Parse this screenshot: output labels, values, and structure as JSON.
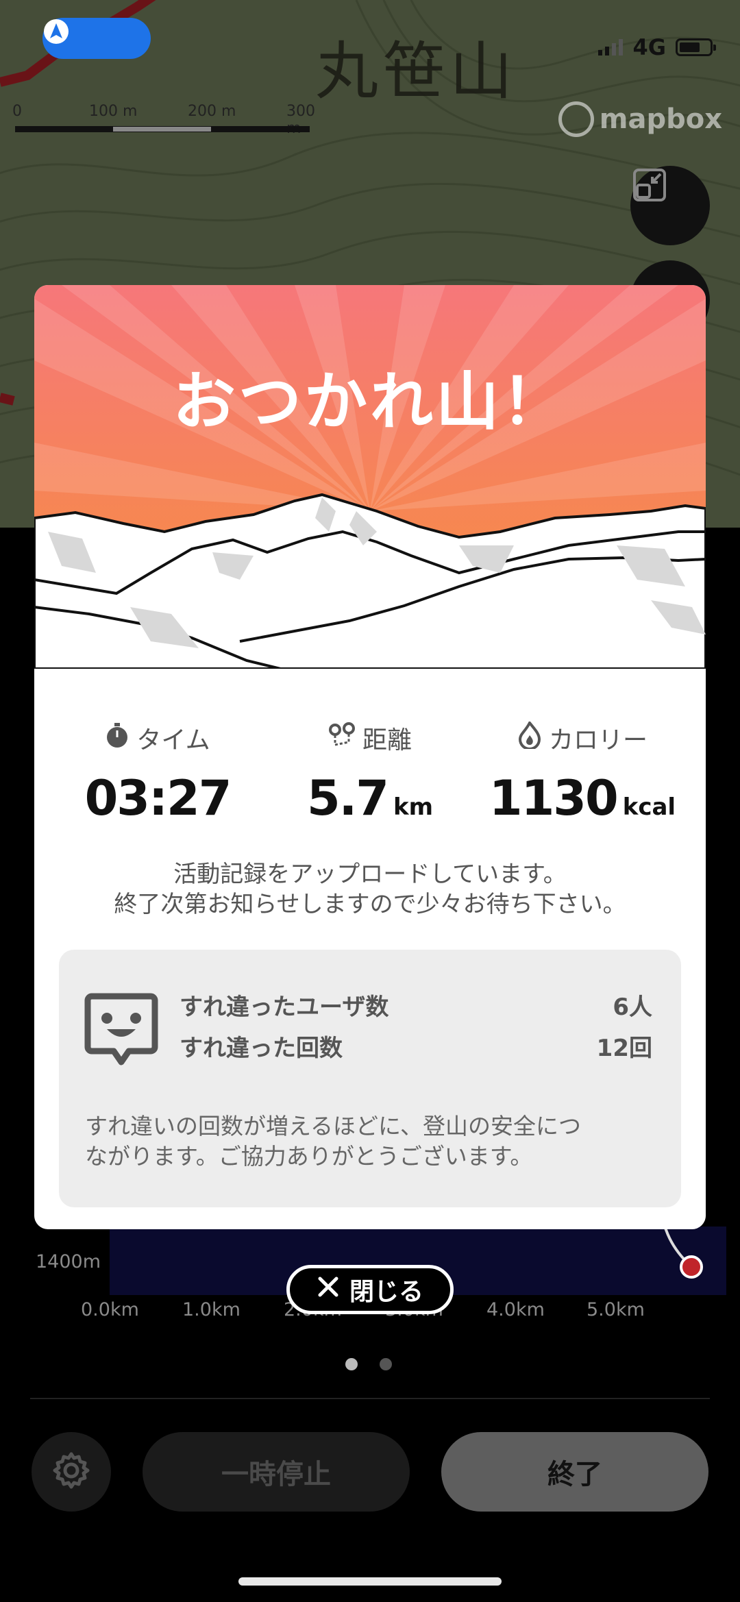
{
  "map": {
    "place_name": "丸笹山",
    "scale_labels": [
      "0",
      "100 m",
      "200 m",
      "300 m"
    ],
    "attribution": "mapbox"
  },
  "status_bar": {
    "network": "4G"
  },
  "modal": {
    "title": "おつかれ山！",
    "stats": {
      "time": {
        "label": "タイム",
        "value": "03:27",
        "unit": ""
      },
      "distance": {
        "label": "距離",
        "value": "5.7",
        "unit": "km"
      },
      "calories": {
        "label": "カロリー",
        "value": "1130",
        "unit": "kcal"
      }
    },
    "upload_message_line1": "活動記録をアップロードしています。",
    "upload_message_line2": "終了次第お知らせしますので少々お待ち下さい。",
    "encounter": {
      "users_label": "すれ違ったユーザ数",
      "users_value": "6人",
      "count_label": "すれ違った回数",
      "count_value": "12回",
      "note_line1": "すれ違いの回数が増えるほどに、登山の安全につ",
      "note_line2": "ながります。ご協力ありがとうございます。"
    }
  },
  "close_button": {
    "label": "閉じる"
  },
  "elevation_chart": {
    "y_label": "1400m",
    "x_ticks": [
      "0.0km",
      "1.0km",
      "2.0km",
      "3.0km",
      "4.0km",
      "5.0km"
    ]
  },
  "pager": {
    "pages": 2,
    "active": 1
  },
  "controls": {
    "pause_label": "一時停止",
    "end_label": "終了"
  },
  "colors": {
    "hero_top": "#f6777a",
    "hero_bottom": "#f7903a",
    "gps_button": "#1e73e8",
    "route_line": "#c0242a"
  }
}
